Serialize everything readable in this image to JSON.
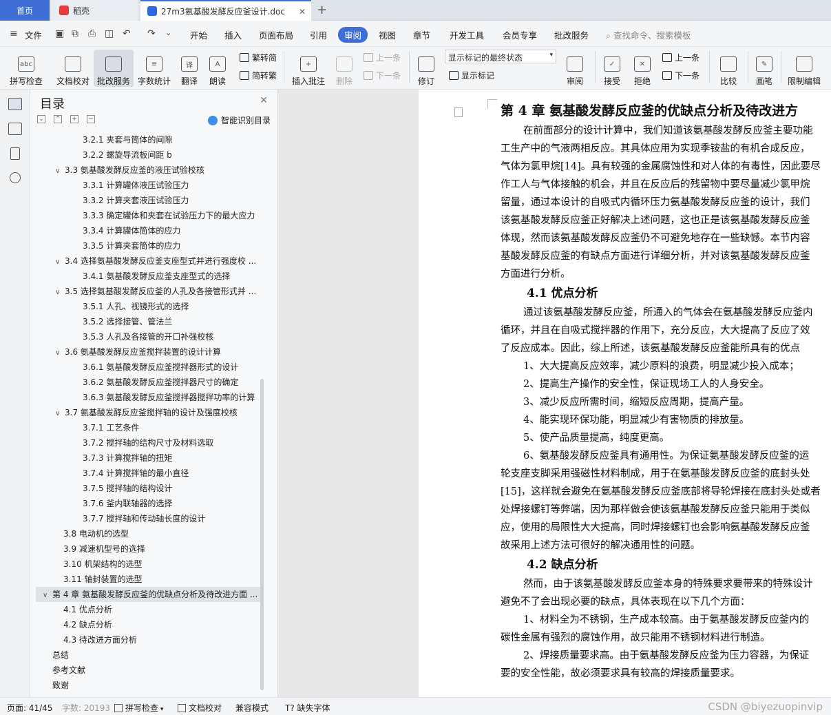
{
  "tabs": {
    "home": "首页",
    "daoke": "稻壳",
    "doc": "27m3氨基酸发酵反应釜设计.doc"
  },
  "menu": {
    "file": "文件",
    "items": [
      "开始",
      "插入",
      "页面布局",
      "引用",
      "审阅",
      "视图",
      "章节",
      "开发工具",
      "会员专享",
      "批改服务"
    ],
    "active": "审阅",
    "search": "查找命令、搜索模板"
  },
  "ribbon": {
    "spell": "拼写检查",
    "proof": "文档校对",
    "correction": "批改服务",
    "wordcount": "字数统计",
    "translate": "翻译",
    "read": "朗读",
    "trad": "繁转简",
    "simp": "简转繁",
    "insert_comment": "插入批注",
    "delete": "删除",
    "prev_comment": "上一条",
    "next_comment": "下一条",
    "revise": "修订",
    "display_mode": "显示标记的最终状态",
    "show_marks": "显示标记",
    "review": "审阅",
    "accept": "接受",
    "reject": "拒绝",
    "prev": "上一条",
    "next": "下一条",
    "compare": "比较",
    "pen": "画笔",
    "restrict": "限制编辑"
  },
  "toc": {
    "title": "目录",
    "smart": "智能识别目录",
    "items": [
      {
        "text": "3.2.1  夹套与筒体的间隙",
        "level": 3
      },
      {
        "text": "3.2.2  螺旋导流板间距 b",
        "level": 3
      },
      {
        "text": "3.3  氨基酸发酵反应釜的液压试验校核",
        "level": 2,
        "arrow": "∨"
      },
      {
        "text": "3.3.1  计算罐体液压试验压力",
        "level": 3
      },
      {
        "text": "3.3.2  计算夹套液压试验压力",
        "level": 3
      },
      {
        "text": "3.3.3  确定罐体和夹套在试验压力下的最大应力",
        "level": 3
      },
      {
        "text": "3.3.4  计算罐体筒体的应力",
        "level": 3
      },
      {
        "text": "3.3.5  计算夹套筒体的应力",
        "level": 3
      },
      {
        "text": "3.4  选择氨基酸发酵反应釜支座型式并进行强度校 ...",
        "level": 2,
        "arrow": "∨"
      },
      {
        "text": "3.4.1  氨基酸发酵反应釜支座型式的选择",
        "level": 3
      },
      {
        "text": "3.5  选择氨基酸发酵反应釜的人孔及各接管形式并 ...",
        "level": 2,
        "arrow": "∨"
      },
      {
        "text": "3.5.1  人孔、视镜形式的选择",
        "level": 3
      },
      {
        "text": "3.5.2  选择接管、管法兰",
        "level": 3
      },
      {
        "text": "3.5.3  人孔及各接管的开口补强校核",
        "level": 3
      },
      {
        "text": "3.6  氨基酸发酵反应釜搅拌装置的设计计算",
        "level": 2,
        "arrow": "∨"
      },
      {
        "text": "3.6.1  氨基酸发酵反应釜搅拌器形式的设计",
        "level": 3
      },
      {
        "text": "3.6.2  氨基酸发酵反应釜搅拌器尺寸的确定",
        "level": 3
      },
      {
        "text": "3.6.3  氨基酸发酵反应釜搅拌器搅拌功率的计算",
        "level": 3
      },
      {
        "text": "3.7  氨基酸发酵反应釜搅拌轴的设计及强度校核",
        "level": 2,
        "arrow": "∨"
      },
      {
        "text": "3.7.1  工艺条件",
        "level": 3
      },
      {
        "text": "3.7.2  搅拌轴的结构尺寸及材料选取",
        "level": 3
      },
      {
        "text": "3.7.3  计算搅拌轴的扭矩",
        "level": 3
      },
      {
        "text": "3.7.4  计算搅拌轴的最小直径",
        "level": 3
      },
      {
        "text": "3.7.5  搅拌轴的结构设计",
        "level": 3
      },
      {
        "text": "3.7.6  釜内联轴器的选择",
        "level": 3
      },
      {
        "text": "3.7.7   搅拌轴和传动轴长度的设计",
        "level": 3
      },
      {
        "text": "3.8  电动机的选型",
        "level": 2
      },
      {
        "text": "3.9  减速机型号的选择",
        "level": 2
      },
      {
        "text": "3.10  机架结构的选型",
        "level": 2
      },
      {
        "text": "3.11  轴封装置的选型",
        "level": 2
      },
      {
        "text": "第 4 章  氨基酸发酵反应釜的优缺点分析及待改进方面 ...",
        "level": 1,
        "arrow": "∨",
        "selected": true
      },
      {
        "text": "4.1  优点分析",
        "level": 2
      },
      {
        "text": "4.2  缺点分析",
        "level": 2
      },
      {
        "text": "4.3  待改进方面分析",
        "level": 2
      },
      {
        "text": "总结",
        "level": 1
      },
      {
        "text": "参考文献",
        "level": 1
      },
      {
        "text": "致谢",
        "level": 1
      }
    ]
  },
  "document": {
    "blocks": [
      {
        "type": "h1",
        "text": "第 4 章  氨基酸发酵反应釜的优缺点分析及待改进方"
      },
      {
        "type": "p",
        "indent": true,
        "text": "在前面部分的设计计算中，我们知道该氨基酸发酵反应釜主要功能"
      },
      {
        "type": "p",
        "text": "工生产中的气液两相反应。其具体应用为实现季铵盐的有机合成反应，"
      },
      {
        "type": "p",
        "text": "气体为氯甲烷[14]。具有较强的金属腐蚀性和对人体的有毒性，因此要尽"
      },
      {
        "type": "p",
        "text": "作工人与气体接触的机会，并且在反应后的残留物中要尽量减少氯甲烷"
      },
      {
        "type": "p",
        "text": "留量，通过本设计的自吸式内循环压力氨基酸发酵反应釜的设计，我们"
      },
      {
        "type": "p",
        "text": "该氨基酸发酵反应釜正好解决上述问题，这也正是该氨基酸发酵反应釜"
      },
      {
        "type": "p",
        "text": "体现，然而该氨基酸发酵反应釜仍不可避免地存在一些缺憾。本节内容"
      },
      {
        "type": "p",
        "text": "基酸发酵反应釜的有缺点方面进行详细分析，并对该氨基酸发酵反应釜"
      },
      {
        "type": "p",
        "text": "方面进行分析。"
      },
      {
        "type": "h2",
        "text": "4.1  优点分析"
      },
      {
        "type": "p",
        "indent": true,
        "text": "通过该氨基酸发酵反应釜，所通入的气体会在氨基酸发酵反应釜内"
      },
      {
        "type": "p",
        "text": "循环，并且在自吸式搅拌器的作用下，充分反应，大大提高了反应了效"
      },
      {
        "type": "p",
        "text": "了反应成本。因此，综上所述，该氨基酸发酵反应釜能所具有的优点"
      },
      {
        "type": "p",
        "indent": true,
        "text": "1、大大提高反应效率，减少原料的浪费，明显减少投入成本；"
      },
      {
        "type": "p",
        "indent": true,
        "text": "2、提高生产操作的安全性，保证现场工人的人身安全。"
      },
      {
        "type": "p",
        "indent": true,
        "text": "3、减少反应所需时间，缩短反应周期，提高产量。"
      },
      {
        "type": "p",
        "indent": true,
        "text": "4、能实现环保功能，明显减少有害物质的排放量。"
      },
      {
        "type": "p",
        "indent": true,
        "text": "5、使产品质量提高，纯度更高。"
      },
      {
        "type": "p",
        "indent": true,
        "text": "6、氨基酸发酵反应釜具有通用性。为保证氨基酸发酵反应釜的运"
      },
      {
        "type": "p",
        "text": "轮支座支脚采用强磁性材料制成，用于在氨基酸发酵反应釜的底封头处"
      },
      {
        "type": "p",
        "text": "[15]，这样就会避免在氨基酸发酵反应釜底部将导轮焊接在底封头处或者"
      },
      {
        "type": "p",
        "text": "处焊接螺钉等弊端，因为那样做会使该氨基酸发酵反应釜只能用于类似"
      },
      {
        "type": "p",
        "text": "应，使用的局限性大大提高，同时焊接螺钉也会影响氨基酸发酵反应釜"
      },
      {
        "type": "p",
        "text": "故采用上述方法可很好的解决通用性的问题。"
      },
      {
        "type": "h2",
        "text": "4.2  缺点分析"
      },
      {
        "type": "p",
        "indent": true,
        "text": "然而，由于该氨基酸发酵反应釜本身的特殊要求要带来的特殊设计"
      },
      {
        "type": "p",
        "text": "避免不了会出现必要的缺点，具体表现在以下几个方面："
      },
      {
        "type": "p",
        "indent": true,
        "text": "1、材料全为不锈钢，生产成本较高。由于氨基酸发酵反应釜内的"
      },
      {
        "type": "p",
        "text": "碳性金属有强烈的腐蚀作用，故只能用不锈钢材料进行制造。"
      },
      {
        "type": "p",
        "indent": true,
        "text": "2、焊接质量要求高。由于氨基酸发酵反应釜为压力容器，为保证"
      },
      {
        "type": "p",
        "text": "要的安全性能，故必须要求具有较高的焊接质量要求。"
      }
    ]
  },
  "status": {
    "page": "页面: 41/45",
    "words": "字数: 20193",
    "spell": "拼写检查",
    "proof": "文档校对",
    "compat": "兼容模式",
    "missing_font": "缺失字体",
    "watermark": "CSDN @biyezuopinvip"
  },
  "colors": {
    "accent": "#3f6fd6",
    "ribbon_bg": "#f4f5f7",
    "toc_bg": "#f7f8fa"
  }
}
